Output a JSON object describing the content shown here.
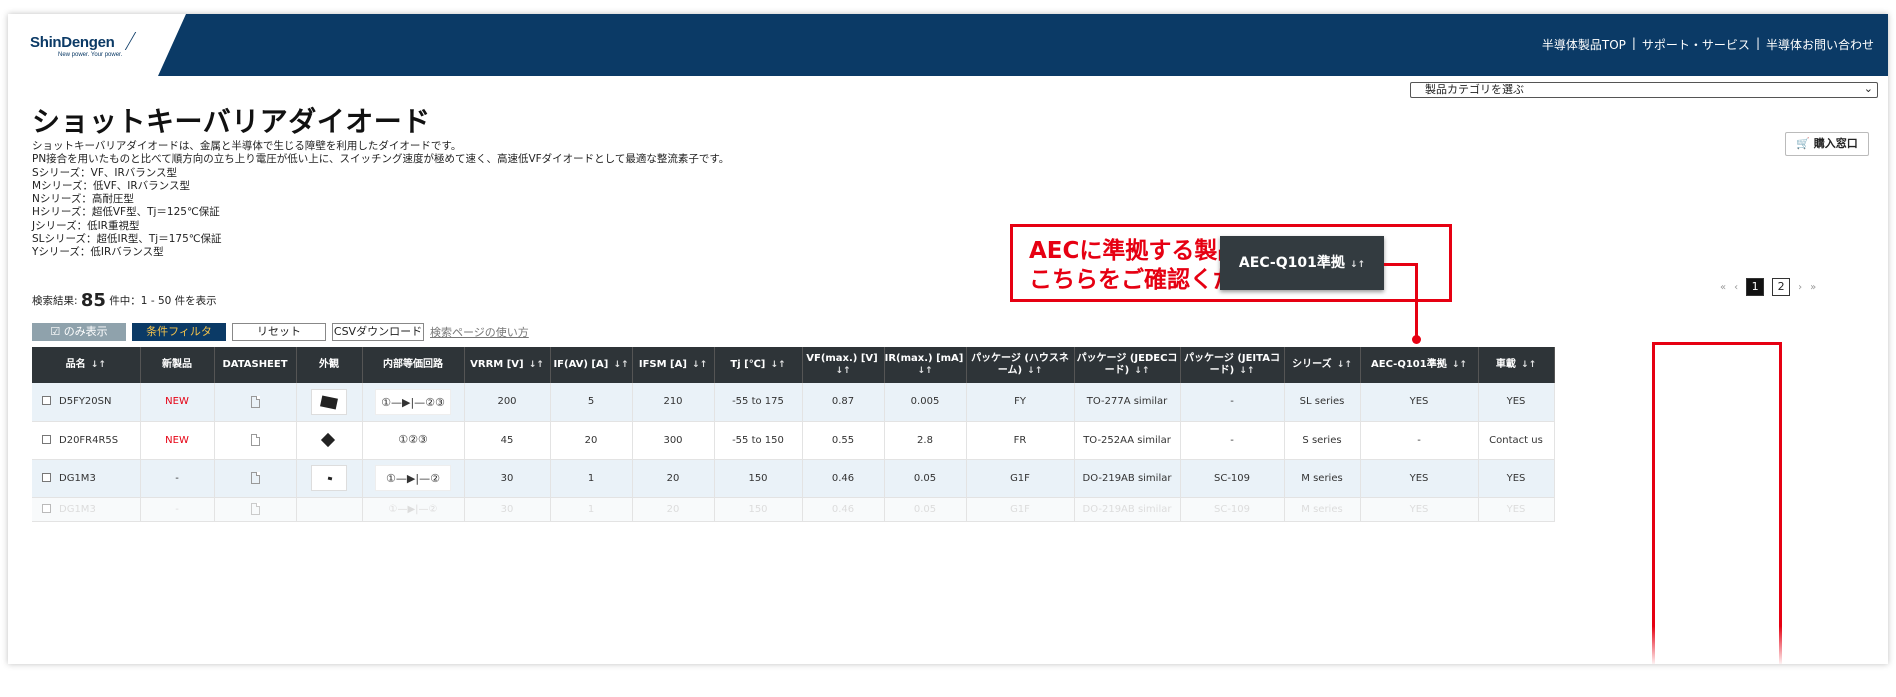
{
  "header": {
    "logo_main": "ShinDengen",
    "logo_sub": "New power. Your power.",
    "nav": [
      "半導体製品TOP",
      "|",
      "サポート・サービス",
      "|",
      "半導体お問い合わせ"
    ]
  },
  "category_select": {
    "value": "製品カテゴリを選ぶ"
  },
  "page_title": "ショットキーバリアダイオード",
  "description": [
    "ショットキーバリアダイオードは、金属と半導体で生じる障壁を利用したダイオードです。",
    "PN接合を用いたものと比べて順方向の立ち上り電圧が低い上に、スイッチング速度が極めて速く、高速低VFダイオードとして最適な整流素子です。",
    "Sシリーズ：VF、IRバランス型",
    "Mシリーズ：低VF、IRバランス型",
    "Nシリーズ：高耐圧型",
    "Hシリーズ：超低VF型、Tj＝125℃保証",
    "Jシリーズ：低IR重視型",
    "SLシリーズ：超低IR型、Tj＝175℃保証",
    "Yシリーズ：低IRバランス型"
  ],
  "buy_button": "購入窓口",
  "callout": {
    "line1": "AECに準拠する製品については",
    "line2": "こちらをご確認ください",
    "button": "AEC-Q101準拠"
  },
  "results": {
    "label": "検索結果:",
    "count": "85",
    "suffix": "件中：1 - 50 件を表示"
  },
  "pager": {
    "first": "«",
    "prev": "‹",
    "pages": [
      "1",
      "2"
    ],
    "next": "›",
    "last": "»"
  },
  "toolbar": {
    "only_show": "のみ表示",
    "filter": "条件フィルタ",
    "reset": "リセット",
    "csv": "CSVダウンロード",
    "help": "検索ページの使い方"
  },
  "table": {
    "headers": [
      "品名",
      "新製品",
      "DATASHEET",
      "外観",
      "内部等価回路",
      "VRRM [V]",
      "IF(AV) [A]",
      "IFSM [A]",
      "Tj [℃]",
      "VF(max.) [V]",
      "IR(max.) [mA]",
      "パッケージ (ハウスネーム)",
      "パッケージ (JEDECコード)",
      "パッケージ (JEITAコード)",
      "シリーズ",
      "AEC-Q101準拠",
      "車載"
    ],
    "rows": [
      [
        "D5FY20SN",
        "NEW",
        "",
        "",
        "①—▶|—②③",
        "200",
        "5",
        "210",
        "-55 to 175",
        "0.87",
        "0.005",
        "FY",
        "TO-277A similar",
        "-",
        "SL series",
        "YES",
        "YES"
      ],
      [
        "D20FR4R5S",
        "NEW",
        "",
        "",
        "①②③",
        "45",
        "20",
        "300",
        "-55 to 150",
        "0.55",
        "2.8",
        "FR",
        "TO-252AA similar",
        "-",
        "S series",
        "-",
        "Contact us"
      ],
      [
        "DG1M3",
        "-",
        "",
        "",
        "①—▶|—②",
        "30",
        "1",
        "20",
        "150",
        "0.46",
        "0.05",
        "G1F",
        "DO-219AB similar",
        "SC-109",
        "M series",
        "YES",
        "YES"
      ],
      [
        "DG1M3",
        "-",
        "",
        "",
        "①—▶|—②",
        "30",
        "1",
        "20",
        "150",
        "0.46",
        "0.05",
        "G1F",
        "DO-219AB similar",
        "SC-109",
        "M series",
        "YES",
        "YES"
      ]
    ]
  },
  "colors": {
    "navy": "#0b3a66",
    "red": "#e60012",
    "header_dark": "#2e3438"
  }
}
